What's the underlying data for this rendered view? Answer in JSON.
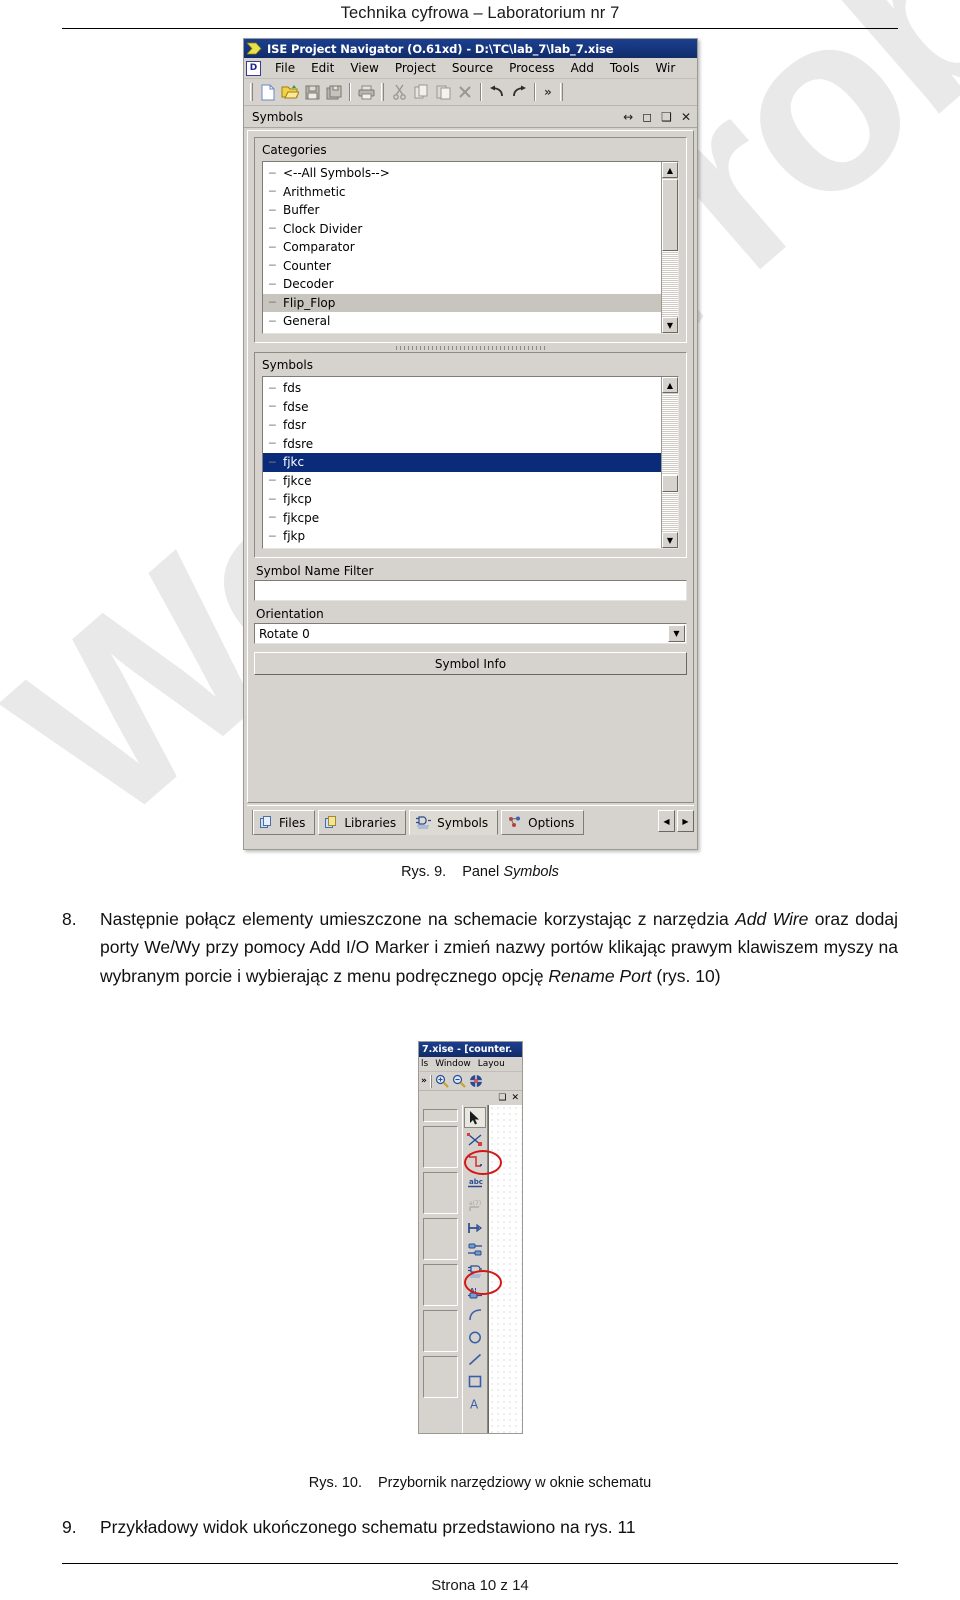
{
  "document": {
    "header_title": "Technika cyfrowa – Laboratorium nr 7",
    "footer_text": "Strona 10 z 14",
    "watermark": "Wersja robocza"
  },
  "figure9": {
    "caption_label": "Rys. 9.",
    "caption_text_plain": "Panel ",
    "caption_text_italic": "Symbols",
    "window": {
      "title": "ISE Project Navigator (O.61xd) - D:\\TC\\lab_7\\lab_7.xise",
      "menu": [
        "File",
        "Edit",
        "View",
        "Project",
        "Source",
        "Process",
        "Add",
        "Tools",
        "Wir"
      ],
      "toolbar_icons": [
        "new-file-icon",
        "open-folder-icon",
        "save-icon",
        "save-all-icon",
        "print-icon",
        "cut-icon",
        "copy-icon",
        "paste-icon",
        "delete-icon",
        "undo-icon",
        "redo-icon",
        "more-chevron-icon"
      ],
      "panel_caption": "Symbols",
      "panel_buttons": [
        "dock-arrows-icon",
        "maximize-icon",
        "restore-icon",
        "close-icon"
      ],
      "categories": {
        "label": "Categories",
        "items": [
          {
            "label": "<--All Symbols-->",
            "state": "normal"
          },
          {
            "label": "Arithmetic",
            "state": "normal"
          },
          {
            "label": "Buffer",
            "state": "normal"
          },
          {
            "label": "Clock Divider",
            "state": "normal"
          },
          {
            "label": "Comparator",
            "state": "normal"
          },
          {
            "label": "Counter",
            "state": "normal"
          },
          {
            "label": "Decoder",
            "state": "normal"
          },
          {
            "label": "Flip_Flop",
            "state": "selected-inactive"
          },
          {
            "label": "General",
            "state": "normal"
          }
        ]
      },
      "symbols": {
        "label": "Symbols",
        "items": [
          {
            "label": "fds",
            "state": "normal"
          },
          {
            "label": "fdse",
            "state": "normal"
          },
          {
            "label": "fdsr",
            "state": "normal"
          },
          {
            "label": "fdsre",
            "state": "normal"
          },
          {
            "label": "fjkc",
            "state": "selected"
          },
          {
            "label": "fjkce",
            "state": "normal"
          },
          {
            "label": "fjkcp",
            "state": "normal"
          },
          {
            "label": "fjkcpe",
            "state": "normal"
          },
          {
            "label": "fjkp",
            "state": "normal"
          }
        ]
      },
      "symbol_name_filter": {
        "label": "Symbol Name Filter",
        "value": "",
        "placeholder": ""
      },
      "orientation": {
        "label": "Orientation",
        "value": "Rotate 0"
      },
      "symbol_info_button": "Symbol Info",
      "tabs": [
        {
          "label": "Files",
          "icon": "files-icon",
          "active": false
        },
        {
          "label": "Libraries",
          "icon": "libraries-icon",
          "active": false
        },
        {
          "label": "Symbols",
          "icon": "symbols-icon",
          "active": true
        },
        {
          "label": "Options",
          "icon": "options-icon",
          "active": false
        }
      ]
    }
  },
  "step8": {
    "number": "8.",
    "line1_a": "Następnie połącz elementy umieszczone na schemacie korzystając z narzędzia ",
    "line1_b": "Add Wire",
    "line2": " oraz dodaj porty We/Wy przy pomocy Add I/O Marker i zmień nazwy portów klikając prawym klawiszem myszy na wybranym porcie i wybierając z menu podręcznego opcję ",
    "line3_a": "Rename Port",
    "line3_b": " (rys. 10)"
  },
  "figure10": {
    "caption_label": "Rys. 10.",
    "caption_text": "Przybornik narzędziowy w oknie schematu",
    "window": {
      "title": "7.xise - [counter.",
      "menu": [
        "ls",
        "Window",
        "Layou"
      ],
      "toolbar_icons": [
        "more-chevron-icon",
        "zoom-in-icon",
        "zoom-out-icon",
        "zoom-fit-icon"
      ],
      "panel_buttons": [
        "restore-icon",
        "close-icon"
      ],
      "palette_tools": [
        {
          "name": "select-arrow-tool",
          "state": "pressed"
        },
        {
          "name": "add-symbol-tool",
          "state": "normal"
        },
        {
          "name": "add-wire-tool",
          "state": "circled"
        },
        {
          "name": "add-net-name-tool",
          "state": "normal"
        },
        {
          "name": "add-bus-tap-tool",
          "state": "disabled"
        },
        {
          "name": "add-io-marker-tool",
          "state": "normal"
        },
        {
          "name": "rename-port-tool",
          "state": "circled"
        },
        {
          "name": "add-instance-name-tool",
          "state": "normal"
        },
        {
          "name": "add-attribute-tool",
          "state": "normal"
        },
        {
          "name": "draw-arc-tool",
          "state": "normal"
        },
        {
          "name": "draw-circle-tool",
          "state": "normal"
        },
        {
          "name": "draw-line-tool",
          "state": "normal"
        },
        {
          "name": "draw-rectangle-tool",
          "state": "normal"
        },
        {
          "name": "add-text-tool",
          "state": "normal"
        }
      ],
      "annotation_color": "#d41616"
    }
  },
  "step9": {
    "number": "9.",
    "text": "Przykładowy widok ukończonego schematu przedstawiono na rys. 11"
  }
}
